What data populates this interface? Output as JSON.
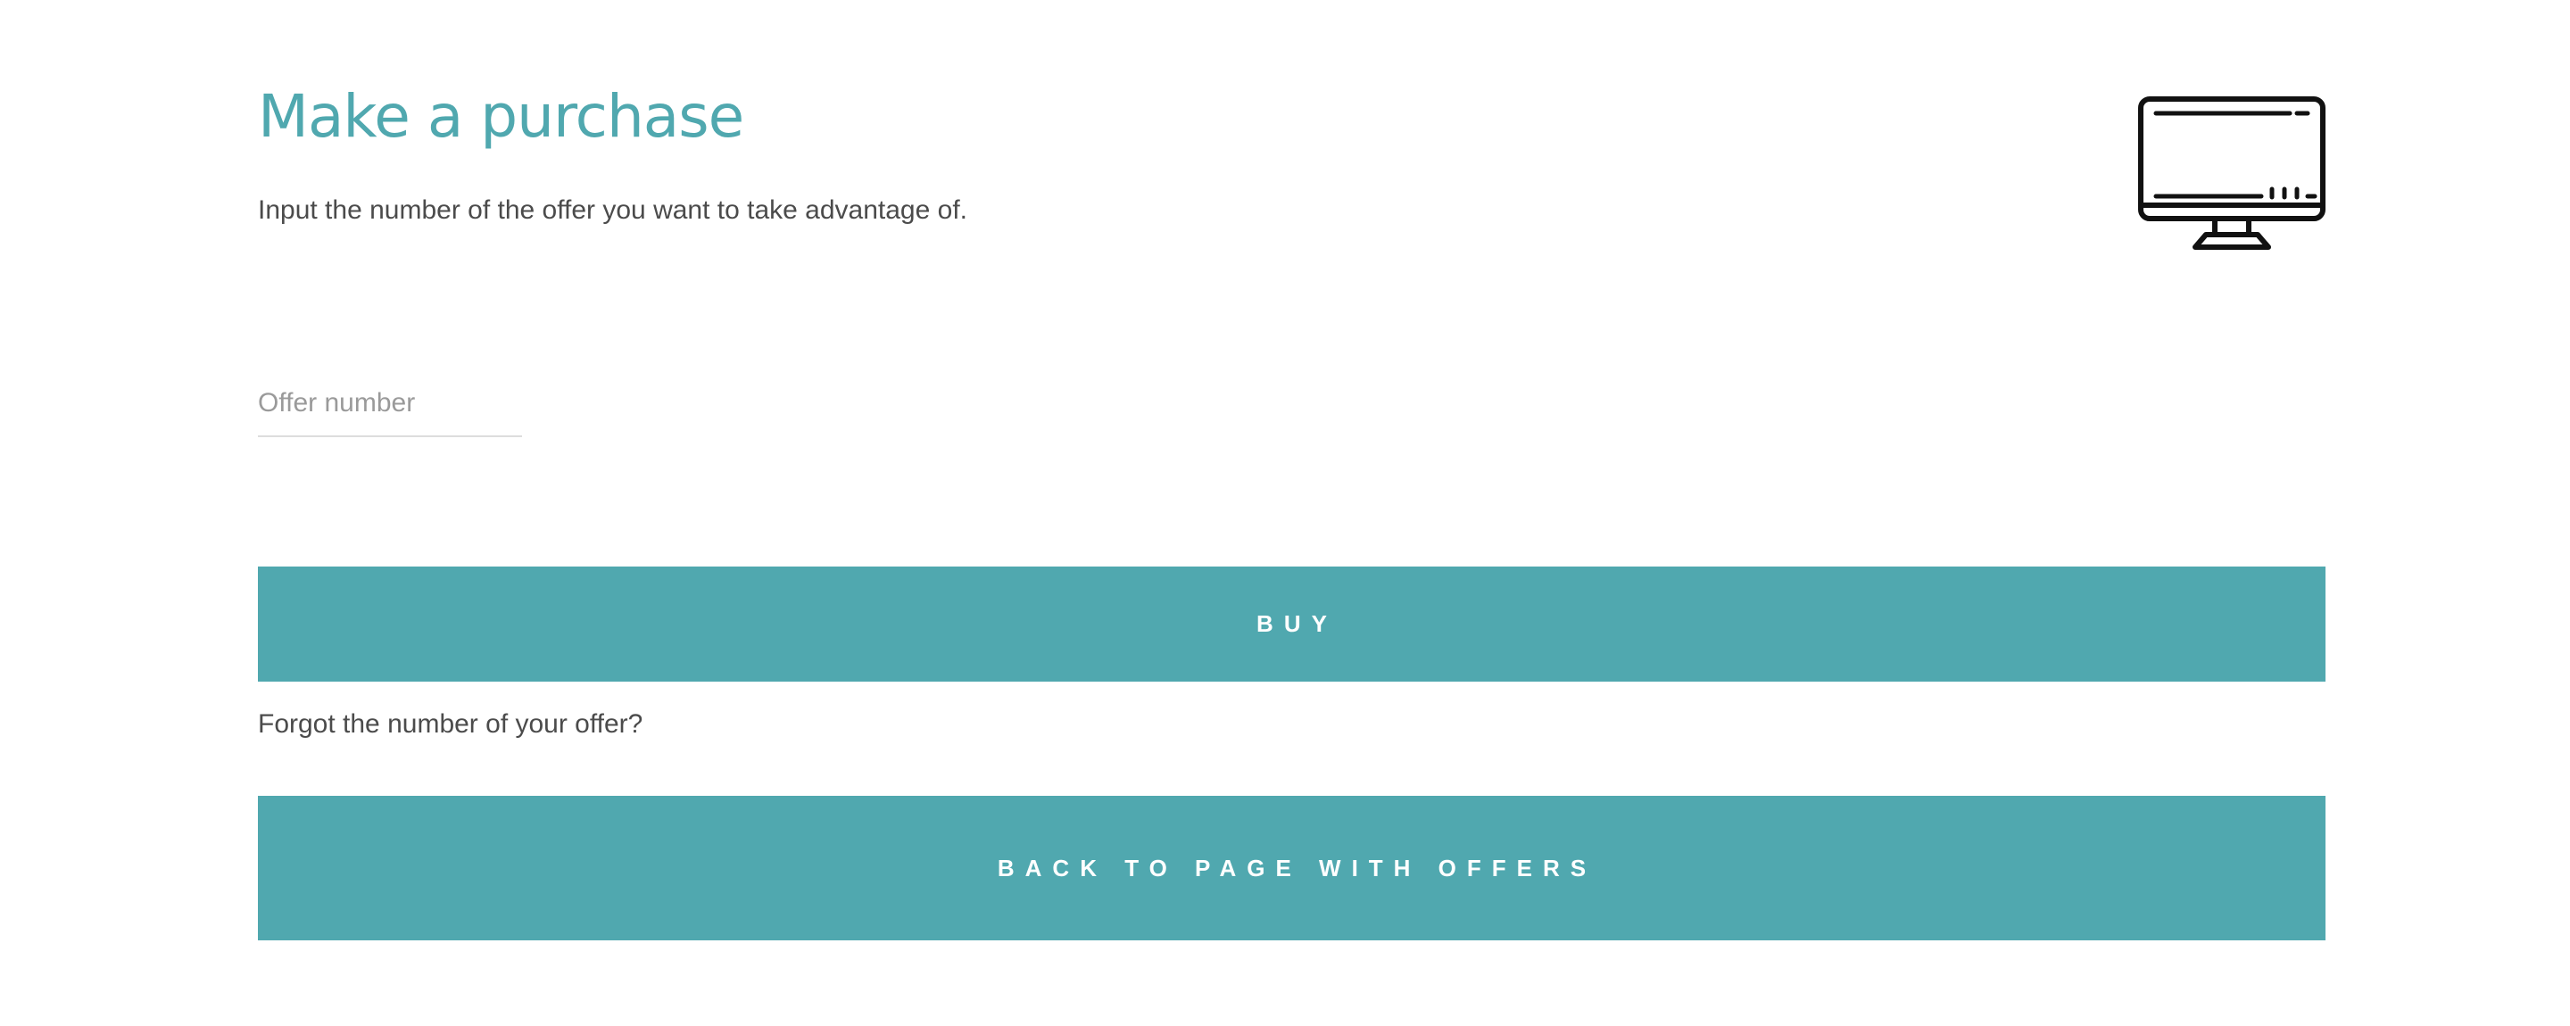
{
  "colors": {
    "accent": "#50a8af",
    "text": "#4b4b4b",
    "placeholder": "#9a9a9a",
    "icon": "#111111"
  },
  "header": {
    "title": "Make a purchase",
    "subtitle": "Input the number of the offer you want to take advantage of.",
    "icon": "monitor-icon"
  },
  "form": {
    "offer_number": {
      "placeholder": "Offer number",
      "value": ""
    },
    "buy_label": "BUY",
    "forgot_text": "Forgot the number of your offer?",
    "back_label": "BACK TO PAGE WITH OFFERS"
  }
}
